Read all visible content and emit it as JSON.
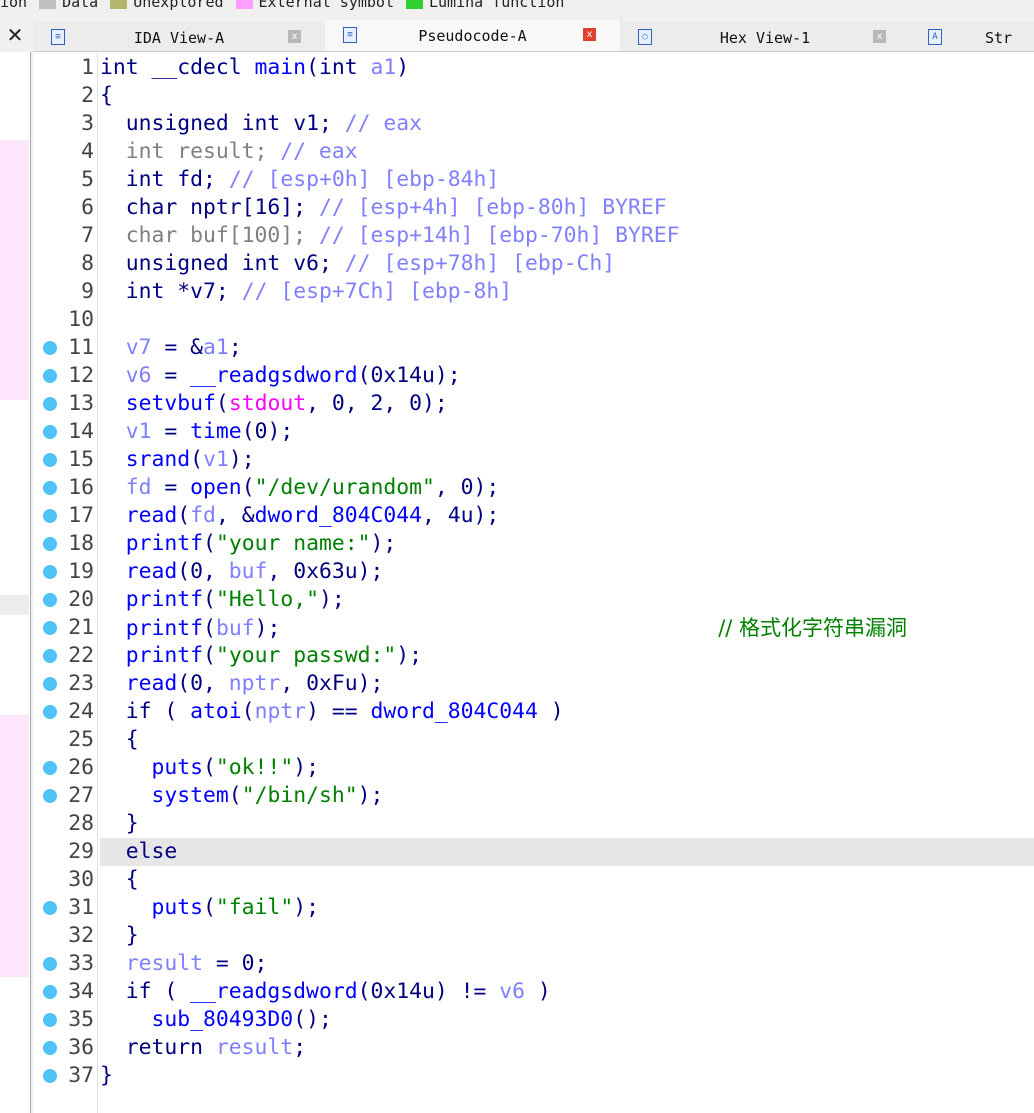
{
  "legend": [
    {
      "label": "ion",
      "color": ""
    },
    {
      "label": "Data",
      "color": "#c0c0c0"
    },
    {
      "label": "Unexplored",
      "color": "#b4b46e"
    },
    {
      "label": "External symbol",
      "color": "#ffa0ff"
    },
    {
      "label": "Lumina function",
      "color": "#30d030"
    }
  ],
  "left_panel": {
    "close": "✕"
  },
  "tabs": [
    {
      "label": "IDA View-A",
      "icon": "disassembly-icon",
      "active": false
    },
    {
      "label": "Pseudocode-A",
      "icon": "pseudocode-icon",
      "active": true
    },
    {
      "label": "Hex View-1",
      "icon": "hex-view-icon",
      "active": false
    },
    {
      "label": "Str",
      "icon": "strings-icon",
      "active": false
    }
  ],
  "highlighted_line": 29,
  "breakpoint_lines": [
    11,
    12,
    13,
    14,
    15,
    16,
    17,
    18,
    19,
    20,
    21,
    22,
    23,
    24,
    26,
    27,
    31,
    33,
    34,
    35,
    36,
    37
  ],
  "lines": [
    [
      [
        "int ",
        "kw"
      ],
      [
        "__cdecl ",
        "kw"
      ],
      [
        "main",
        "fn"
      ],
      [
        "(",
        "pun"
      ],
      [
        "int ",
        "kw"
      ],
      [
        "a1",
        "var"
      ],
      [
        ")",
        "pun"
      ]
    ],
    [
      [
        "{",
        "pun"
      ]
    ],
    [
      [
        "  unsigned int ",
        "kw"
      ],
      [
        "v1",
        "kw"
      ],
      [
        "; ",
        "pun"
      ],
      [
        "// eax",
        "cmt"
      ]
    ],
    [
      [
        "  int result; ",
        "gray"
      ],
      [
        "// eax",
        "cmt"
      ]
    ],
    [
      [
        "  int ",
        "kw"
      ],
      [
        "fd",
        "kw"
      ],
      [
        "; ",
        "pun"
      ],
      [
        "// [esp+0h] [ebp-84h]",
        "cmt"
      ]
    ],
    [
      [
        "  char ",
        "kw"
      ],
      [
        "nptr[16]; ",
        "kw"
      ],
      [
        "// [esp+4h] [ebp-80h] BYREF",
        "cmt"
      ]
    ],
    [
      [
        "  char buf[100]; ",
        "gray"
      ],
      [
        "// [esp+14h] [ebp-70h] BYREF",
        "cmt"
      ]
    ],
    [
      [
        "  unsigned int ",
        "kw"
      ],
      [
        "v6",
        "kw"
      ],
      [
        "; ",
        "pun"
      ],
      [
        "// [esp+78h] [ebp-Ch]",
        "cmt"
      ]
    ],
    [
      [
        "  int ",
        "kw"
      ],
      [
        "*v7",
        "kw"
      ],
      [
        "; ",
        "pun"
      ],
      [
        "// [esp+7Ch] [ebp-8h]",
        "cmt"
      ]
    ],
    [],
    [
      [
        "  ",
        "pun"
      ],
      [
        "v7",
        "var"
      ],
      [
        " = &",
        "pun"
      ],
      [
        "a1",
        "var"
      ],
      [
        ";",
        "pun"
      ]
    ],
    [
      [
        "  ",
        "pun"
      ],
      [
        "v6",
        "var"
      ],
      [
        " = ",
        "pun"
      ],
      [
        "__readgsdword",
        "fn"
      ],
      [
        "(0x14u);",
        "pun"
      ]
    ],
    [
      [
        "  ",
        "pun"
      ],
      [
        "setvbuf",
        "fn"
      ],
      [
        "(",
        "pun"
      ],
      [
        "stdout",
        "ext"
      ],
      [
        ", 0, 2, 0);",
        "pun"
      ]
    ],
    [
      [
        "  ",
        "pun"
      ],
      [
        "v1",
        "var"
      ],
      [
        " = ",
        "pun"
      ],
      [
        "time",
        "fn"
      ],
      [
        "(0);",
        "pun"
      ]
    ],
    [
      [
        "  ",
        "pun"
      ],
      [
        "srand",
        "fn"
      ],
      [
        "(",
        "pun"
      ],
      [
        "v1",
        "var"
      ],
      [
        ");",
        "pun"
      ]
    ],
    [
      [
        "  ",
        "pun"
      ],
      [
        "fd",
        "var"
      ],
      [
        " = ",
        "pun"
      ],
      [
        "open",
        "fn"
      ],
      [
        "(",
        "pun"
      ],
      [
        "\"/dev/urandom\"",
        "str"
      ],
      [
        ", 0);",
        "pun"
      ]
    ],
    [
      [
        "  ",
        "pun"
      ],
      [
        "read",
        "fn"
      ],
      [
        "(",
        "pun"
      ],
      [
        "fd",
        "var"
      ],
      [
        ", &",
        "pun"
      ],
      [
        "dword_804C044",
        "glob"
      ],
      [
        ", 4u);",
        "pun"
      ]
    ],
    [
      [
        "  ",
        "pun"
      ],
      [
        "printf",
        "fn"
      ],
      [
        "(",
        "pun"
      ],
      [
        "\"your name:\"",
        "str"
      ],
      [
        ");",
        "pun"
      ]
    ],
    [
      [
        "  ",
        "pun"
      ],
      [
        "read",
        "fn"
      ],
      [
        "(0, ",
        "pun"
      ],
      [
        "buf",
        "var"
      ],
      [
        ", 0x63u);",
        "pun"
      ]
    ],
    [
      [
        "  ",
        "pun"
      ],
      [
        "printf",
        "fn"
      ],
      [
        "(",
        "pun"
      ],
      [
        "\"Hello,\"",
        "str"
      ],
      [
        ");",
        "pun"
      ]
    ],
    [
      [
        "  ",
        "pun"
      ],
      [
        "printf",
        "fn"
      ],
      [
        "(",
        "pun"
      ],
      [
        "buf",
        "var"
      ],
      [
        ");",
        "pun"
      ],
      [
        "                                  ",
        "pun"
      ],
      [
        "// 格式化字符串漏洞",
        "cmtc"
      ]
    ],
    [
      [
        "  ",
        "pun"
      ],
      [
        "printf",
        "fn"
      ],
      [
        "(",
        "pun"
      ],
      [
        "\"your passwd:\"",
        "str"
      ],
      [
        ");",
        "pun"
      ]
    ],
    [
      [
        "  ",
        "pun"
      ],
      [
        "read",
        "fn"
      ],
      [
        "(0, ",
        "pun"
      ],
      [
        "nptr",
        "var"
      ],
      [
        ", 0xFu);",
        "pun"
      ]
    ],
    [
      [
        "  if ( ",
        "kw"
      ],
      [
        "atoi",
        "fn"
      ],
      [
        "(",
        "pun"
      ],
      [
        "nptr",
        "var"
      ],
      [
        ") == ",
        "pun"
      ],
      [
        "dword_804C044",
        "glob"
      ],
      [
        " )",
        "pun"
      ]
    ],
    [
      [
        "  {",
        "pun"
      ]
    ],
    [
      [
        "    ",
        "pun"
      ],
      [
        "puts",
        "fn"
      ],
      [
        "(",
        "pun"
      ],
      [
        "\"ok!!\"",
        "str"
      ],
      [
        ");",
        "pun"
      ]
    ],
    [
      [
        "    ",
        "pun"
      ],
      [
        "system",
        "fn"
      ],
      [
        "(",
        "pun"
      ],
      [
        "\"/bin/sh\"",
        "str"
      ],
      [
        ");",
        "pun"
      ]
    ],
    [
      [
        "  }",
        "pun"
      ]
    ],
    [
      [
        "  else",
        "kw"
      ]
    ],
    [
      [
        "  {",
        "pun"
      ]
    ],
    [
      [
        "    ",
        "pun"
      ],
      [
        "puts",
        "fn"
      ],
      [
        "(",
        "pun"
      ],
      [
        "\"fail\"",
        "str"
      ],
      [
        ");",
        "pun"
      ]
    ],
    [
      [
        "  }",
        "pun"
      ]
    ],
    [
      [
        "  ",
        "pun"
      ],
      [
        "result",
        "var"
      ],
      [
        " = 0;",
        "pun"
      ]
    ],
    [
      [
        "  if ( ",
        "kw"
      ],
      [
        "__readgsdword",
        "fn"
      ],
      [
        "(0x14u) != ",
        "pun"
      ],
      [
        "v6",
        "var"
      ],
      [
        " )",
        "pun"
      ]
    ],
    [
      [
        "    ",
        "pun"
      ],
      [
        "sub_80493D0",
        "fn"
      ],
      [
        "();",
        "pun"
      ]
    ],
    [
      [
        "  return ",
        "kw"
      ],
      [
        "result",
        "var"
      ],
      [
        ";",
        "pun"
      ]
    ],
    [
      [
        "}",
        "pun"
      ]
    ]
  ]
}
